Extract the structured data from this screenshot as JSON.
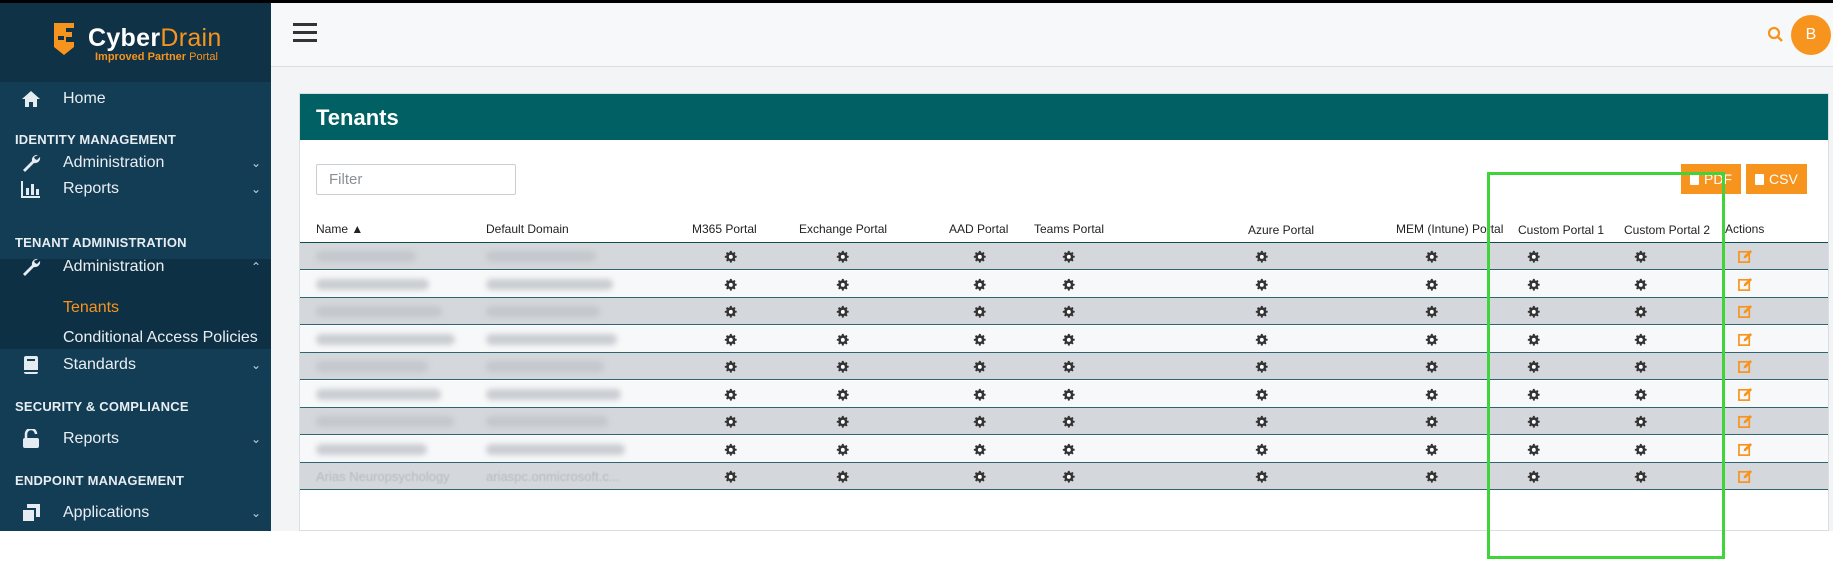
{
  "app": {
    "name_part1": "Cyber",
    "name_part2": "Drain",
    "subtitle_bold": "Improved Partner",
    "subtitle_rest": " Portal",
    "brand_color": "#f7941d",
    "sidebar_color": "#133c55",
    "header_color": "#006064"
  },
  "sidebar": {
    "home": {
      "label": "Home",
      "icon": "home-icon"
    },
    "sections": [
      {
        "title": "IDENTITY MANAGEMENT"
      },
      {
        "title": "TENANT ADMINISTRATION"
      },
      {
        "title": "SECURITY & COMPLIANCE"
      },
      {
        "title": "ENDPOINT MANAGEMENT"
      }
    ],
    "items": [
      {
        "label": "Administration",
        "icon": "wrench-icon",
        "expanded": false
      },
      {
        "label": "Reports",
        "icon": "bar-chart-icon",
        "expanded": false
      },
      {
        "label": "Administration",
        "icon": "wrench-icon",
        "expanded": true
      },
      {
        "label": "Standards",
        "icon": "book-icon",
        "expanded": false
      },
      {
        "label": "Reports",
        "icon": "lock-open-icon",
        "expanded": false
      },
      {
        "label": "Applications",
        "icon": "layers-icon",
        "expanded": false
      }
    ],
    "subitems": [
      {
        "label": "Tenants",
        "active": true
      },
      {
        "label": "Conditional Access Policies",
        "active": false
      }
    ]
  },
  "topbar": {
    "avatar_initial": "B"
  },
  "card": {
    "title": "Tenants",
    "filter_placeholder": "Filter",
    "export_pdf": "PDF",
    "export_csv": "CSV"
  },
  "table": {
    "columns": [
      "Name ▲",
      "Default Domain",
      "M365 Portal",
      "Exchange Portal",
      "AAD Portal",
      "Teams Portal",
      "Azure Portal",
      "MEM (Intune) Portal",
      "Custom Portal 1",
      "Custom Portal 2",
      "Actions"
    ],
    "rows": [
      {
        "name": "",
        "domain": ""
      },
      {
        "name": "",
        "domain": ""
      },
      {
        "name": "",
        "domain": ""
      },
      {
        "name": "",
        "domain": ""
      },
      {
        "name": "",
        "domain": ""
      },
      {
        "name": "",
        "domain": ""
      },
      {
        "name": "",
        "domain": ""
      },
      {
        "name": "",
        "domain": ""
      },
      {
        "name": "Arias Neuropsychology",
        "domain": "ariaspc.onmicrosoft.c..."
      }
    ]
  }
}
